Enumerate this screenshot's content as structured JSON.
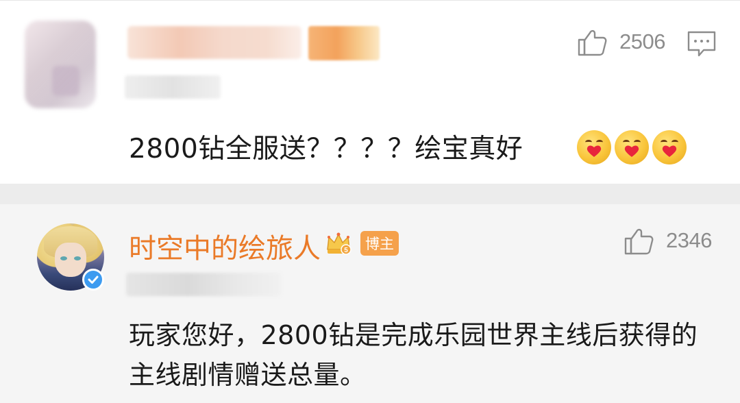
{
  "top_comment": {
    "like_count": "2506",
    "text": "2800钻全服送？？？？绘宝真好",
    "emojis": [
      "hug-emoji",
      "hug-emoji",
      "hug-emoji"
    ]
  },
  "reply": {
    "author": "时空中的绘旅人",
    "member_badge": "crown-icon",
    "host_badge": "博主",
    "like_count": "2346",
    "text": "玩家您好，2800钻是完成乐园世界主线后获得的主线剧情赠送总量。"
  },
  "colors": {
    "author_name": "#ea7a28",
    "host_badge_bg": "#f5a14b",
    "verify_badge": "#3d9bf0",
    "like_count": "#8c8c8c",
    "separator": "#ececec",
    "reply_bg": "#f5f5f5"
  },
  "icons": {
    "like": "thumbs-up-icon",
    "reply": "comment-bubble-icon",
    "verified": "verified-check-icon"
  }
}
